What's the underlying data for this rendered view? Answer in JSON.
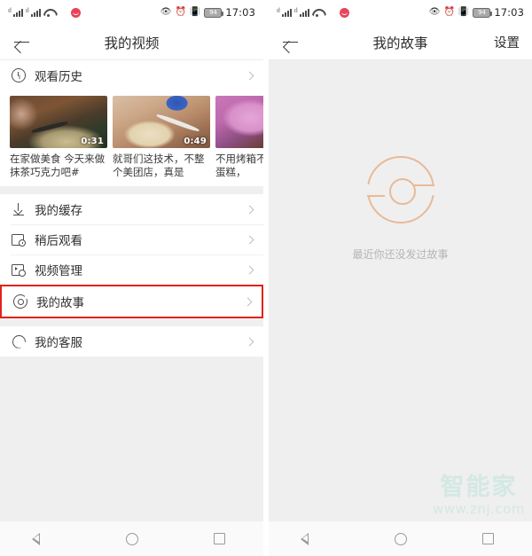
{
  "status_bar": {
    "signal_label": "signal-bars",
    "wifi_label": "wifi-icon",
    "app_badge": "app-notification-icon",
    "eye_icon": "👁",
    "alarm_icon": "⏰",
    "vibrate_icon": "📳",
    "battery_level": "94",
    "time": "17:03"
  },
  "left_screen": {
    "header": {
      "back_icon": "back-arrow",
      "title": "我的视频"
    },
    "history_row": {
      "icon": "clock-icon",
      "label": "观看历史",
      "chevron": "chevron-right-icon"
    },
    "videos": [
      {
        "duration": "0:31",
        "title": "在家做美食 今天来做抹茶巧克力吧#"
      },
      {
        "duration": "0:49",
        "title": "就哥们这技术，不整个美团店，真是"
      },
      {
        "duration": "",
        "title": "不用烤箱不用的酸奶蛋糕，"
      }
    ],
    "menu": [
      {
        "icon": "download-icon",
        "label": "我的缓存",
        "highlighted": false
      },
      {
        "icon": "watch-later-icon",
        "label": "稍后观看",
        "highlighted": false
      },
      {
        "icon": "video-manage-icon",
        "label": "视频管理",
        "highlighted": false
      },
      {
        "icon": "story-icon",
        "label": "我的故事",
        "highlighted": true
      },
      {
        "icon": "headset-icon",
        "label": "我的客服",
        "highlighted": false
      }
    ]
  },
  "right_screen": {
    "header": {
      "back_icon": "back-arrow",
      "title": "我的故事",
      "action_label": "设置"
    },
    "empty_state": {
      "logo": "story-logo",
      "message": "最近你还没发过故事",
      "logo_color": "#e9b996"
    },
    "watermark": {
      "brand": "智能家",
      "url": "www.znj.com"
    }
  },
  "nav_bar": {
    "back": "nav-back-icon",
    "home": "nav-home-icon",
    "recents": "nav-recents-icon"
  },
  "colors": {
    "highlight_border": "#e2221c",
    "background": "#efefef",
    "card": "#ffffff"
  }
}
